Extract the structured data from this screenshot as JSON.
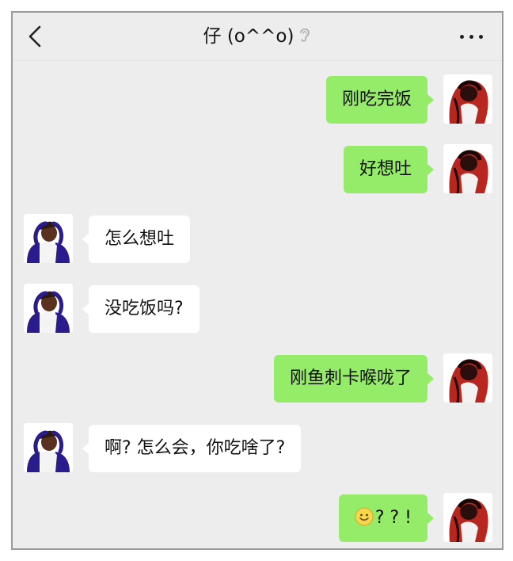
{
  "header": {
    "back_icon": "chevron-left-icon",
    "title": "仔 (o^^o)",
    "mute_icon": "ear-muted-icon",
    "more_icon": "more-dots-icon"
  },
  "messages": [
    {
      "side": "right",
      "text": "刚吃完饭",
      "avatar": "avatar-me"
    },
    {
      "side": "right",
      "text": "好想吐",
      "avatar": "avatar-me"
    },
    {
      "side": "left",
      "text": "怎么想吐",
      "avatar": "avatar-friend"
    },
    {
      "side": "left",
      "text": "没吃饭吗?",
      "avatar": "avatar-friend"
    },
    {
      "side": "right",
      "text": "刚鱼刺卡喉咙了",
      "avatar": "avatar-me"
    },
    {
      "side": "left",
      "text": "啊? 怎么会，你吃啥了?",
      "avatar": "avatar-friend"
    },
    {
      "side": "right",
      "text": "? ? !",
      "emoji": "smiley-face-icon",
      "avatar": "avatar-me"
    }
  ],
  "colors": {
    "background": "#ededed",
    "sent_bubble": "#95ec69",
    "received_bubble": "#ffffff"
  }
}
